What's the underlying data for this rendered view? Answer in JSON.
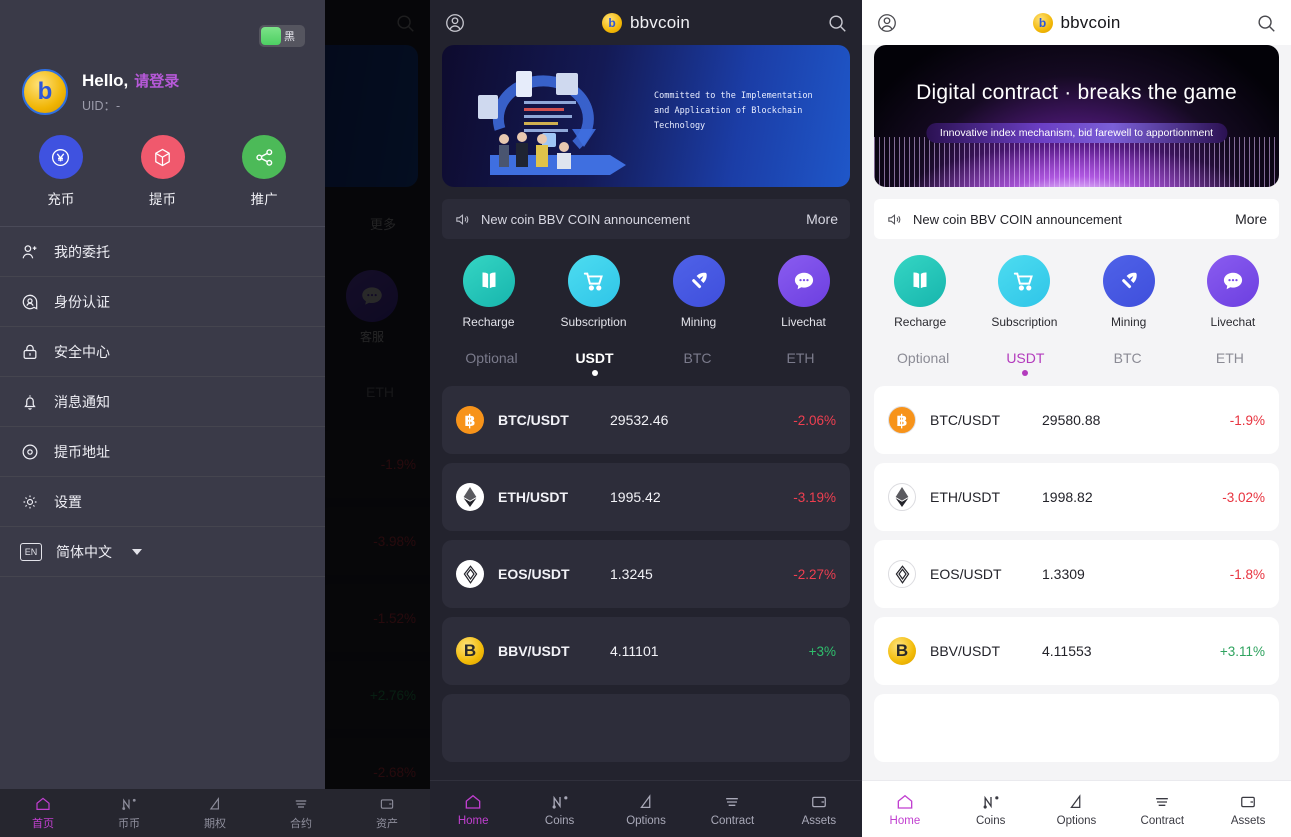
{
  "app": {
    "brand": "bbvcoin",
    "brand_mark": "b"
  },
  "panel_drawer": {
    "theme_toggle": {
      "label": "黑",
      "state_on": true,
      "knob_color": "#4dcf63"
    },
    "profile": {
      "greeting": "Hello,",
      "login_link": "请登录",
      "uid_label": "UID：",
      "uid_value": "-",
      "avatar_glyph": "b"
    },
    "quick_actions": [
      {
        "label": "充币",
        "icon": "yuan-circle-icon",
        "color": "#3f52e0"
      },
      {
        "label": "提币",
        "icon": "cube-circle-icon",
        "color": "#f0596d"
      },
      {
        "label": "推广",
        "icon": "share-nodes-icon",
        "color": "#4cba58"
      }
    ],
    "menu": [
      {
        "label": "我的委托",
        "icon": "user-plus-icon"
      },
      {
        "label": "身份认证",
        "icon": "id-badge-icon"
      },
      {
        "label": "安全中心",
        "icon": "lock-icon"
      },
      {
        "label": "消息通知",
        "icon": "bell-icon"
      },
      {
        "label": "提币地址",
        "icon": "map-pin-icon"
      },
      {
        "label": "设置",
        "icon": "gear-icon"
      },
      {
        "label": "简体中文",
        "icon": "language-en-icon",
        "has_caret": true
      }
    ],
    "bottom_nav": [
      {
        "label": "首页",
        "icon": "home-icon",
        "active": true
      },
      {
        "label": "币币",
        "icon": "chart-zigzag-icon",
        "active": false
      },
      {
        "label": "期权",
        "icon": "triangle-options-icon",
        "active": false
      },
      {
        "label": "合约",
        "icon": "contract-lines-icon",
        "active": false
      },
      {
        "label": "资产",
        "icon": "wallet-icon",
        "active": false
      }
    ],
    "background_peek": {
      "more_label": "更多",
      "support_label": "客服",
      "eth_tab": "ETH",
      "changes": [
        "-1.9%",
        "-3.98%",
        "-1.52%",
        "+2.76%",
        "-2.68%"
      ]
    }
  },
  "panel_dark_home": {
    "theme": "dark",
    "header": {
      "title": "bbvcoin",
      "profile_icon": "user-circle-icon",
      "search_icon": "search-icon"
    },
    "banner": {
      "kind": "blockchain-illustration",
      "text_lines": [
        "Committed to the Implementation",
        "and Application of Blockchain",
        "Technology"
      ]
    },
    "announcement": {
      "icon": "megaphone-icon",
      "text": "New coin BBV COIN announcement",
      "more": "More"
    },
    "quick_actions": [
      {
        "label": "Recharge",
        "icon": "book-icon",
        "class": "c-recharge"
      },
      {
        "label": "Subscription",
        "icon": "cart-icon",
        "class": "c-subscription"
      },
      {
        "label": "Mining",
        "icon": "pickaxe-icon",
        "class": "c-mining"
      },
      {
        "label": "Livechat",
        "icon": "chat-bubble-icon",
        "class": "c-livechat"
      }
    ],
    "market_tabs": [
      {
        "label": "Optional",
        "active": false
      },
      {
        "label": "USDT",
        "active": true
      },
      {
        "label": "BTC",
        "active": false
      },
      {
        "label": "ETH",
        "active": false
      }
    ],
    "market_rows": [
      {
        "pair": "BTC/USDT",
        "price": "29532.46",
        "change": "-2.06%",
        "dir": "down",
        "icon": "btc-icon"
      },
      {
        "pair": "ETH/USDT",
        "price": "1995.42",
        "change": "-3.19%",
        "dir": "down",
        "icon": "eth-icon"
      },
      {
        "pair": "EOS/USDT",
        "price": "1.3245",
        "change": "-2.27%",
        "dir": "down",
        "icon": "eos-icon"
      },
      {
        "pair": "BBV/USDT",
        "price": "4.11101",
        "change": "+3%",
        "dir": "up",
        "icon": "bbv-icon"
      }
    ],
    "bottom_nav": [
      {
        "label": "Home",
        "icon": "home-icon",
        "active": true
      },
      {
        "label": "Coins",
        "icon": "chart-zigzag-icon",
        "active": false
      },
      {
        "label": "Options",
        "icon": "triangle-options-icon",
        "active": false
      },
      {
        "label": "Contract",
        "icon": "contract-lines-icon",
        "active": false
      },
      {
        "label": "Assets",
        "icon": "wallet-icon",
        "active": false
      }
    ]
  },
  "panel_light_home": {
    "theme": "light",
    "header": {
      "title": "bbvcoin",
      "profile_icon": "user-circle-icon",
      "search_icon": "search-icon"
    },
    "banner": {
      "kind": "digital-contract",
      "title": "Digital contract · breaks the game",
      "pill": "Innovative index mechanism, bid farewell to apportionment"
    },
    "announcement": {
      "icon": "megaphone-icon",
      "text": "New coin BBV COIN announcement",
      "more": "More"
    },
    "quick_actions": [
      {
        "label": "Recharge",
        "icon": "book-icon",
        "class": "c-recharge"
      },
      {
        "label": "Subscription",
        "icon": "cart-icon",
        "class": "c-subscription"
      },
      {
        "label": "Mining",
        "icon": "pickaxe-icon",
        "class": "c-mining"
      },
      {
        "label": "Livechat",
        "icon": "chat-bubble-icon",
        "class": "c-livechat"
      }
    ],
    "market_tabs": [
      {
        "label": "Optional",
        "active": false
      },
      {
        "label": "USDT",
        "active": true
      },
      {
        "label": "BTC",
        "active": false
      },
      {
        "label": "ETH",
        "active": false
      }
    ],
    "market_rows": [
      {
        "pair": "BTC/USDT",
        "price": "29580.88",
        "change": "-1.9%",
        "dir": "down",
        "icon": "btc-icon"
      },
      {
        "pair": "ETH/USDT",
        "price": "1998.82",
        "change": "-3.02%",
        "dir": "down",
        "icon": "eth-icon"
      },
      {
        "pair": "EOS/USDT",
        "price": "1.3309",
        "change": "-1.8%",
        "dir": "down",
        "icon": "eos-icon"
      },
      {
        "pair": "BBV/USDT",
        "price": "4.11553",
        "change": "+3.11%",
        "dir": "up",
        "icon": "bbv-icon"
      }
    ],
    "bottom_nav": [
      {
        "label": "Home",
        "icon": "home-icon",
        "active": true
      },
      {
        "label": "Coins",
        "icon": "chart-zigzag-icon",
        "active": false
      },
      {
        "label": "Options",
        "icon": "triangle-options-icon",
        "active": false
      },
      {
        "label": "Contract",
        "icon": "contract-lines-icon",
        "active": false
      },
      {
        "label": "Assets",
        "icon": "wallet-icon",
        "active": false
      }
    ]
  },
  "colors": {
    "accent_magenta": "#c13fd0",
    "up_green": "#2fbf6d",
    "down_red": "#ef3f50",
    "dark_bg": "#23232e",
    "dark_card": "#2d2d3a",
    "light_bg": "#f4f4f6",
    "drawer_bg": "#3a3a48",
    "brand_gold": "#f2bb08"
  }
}
